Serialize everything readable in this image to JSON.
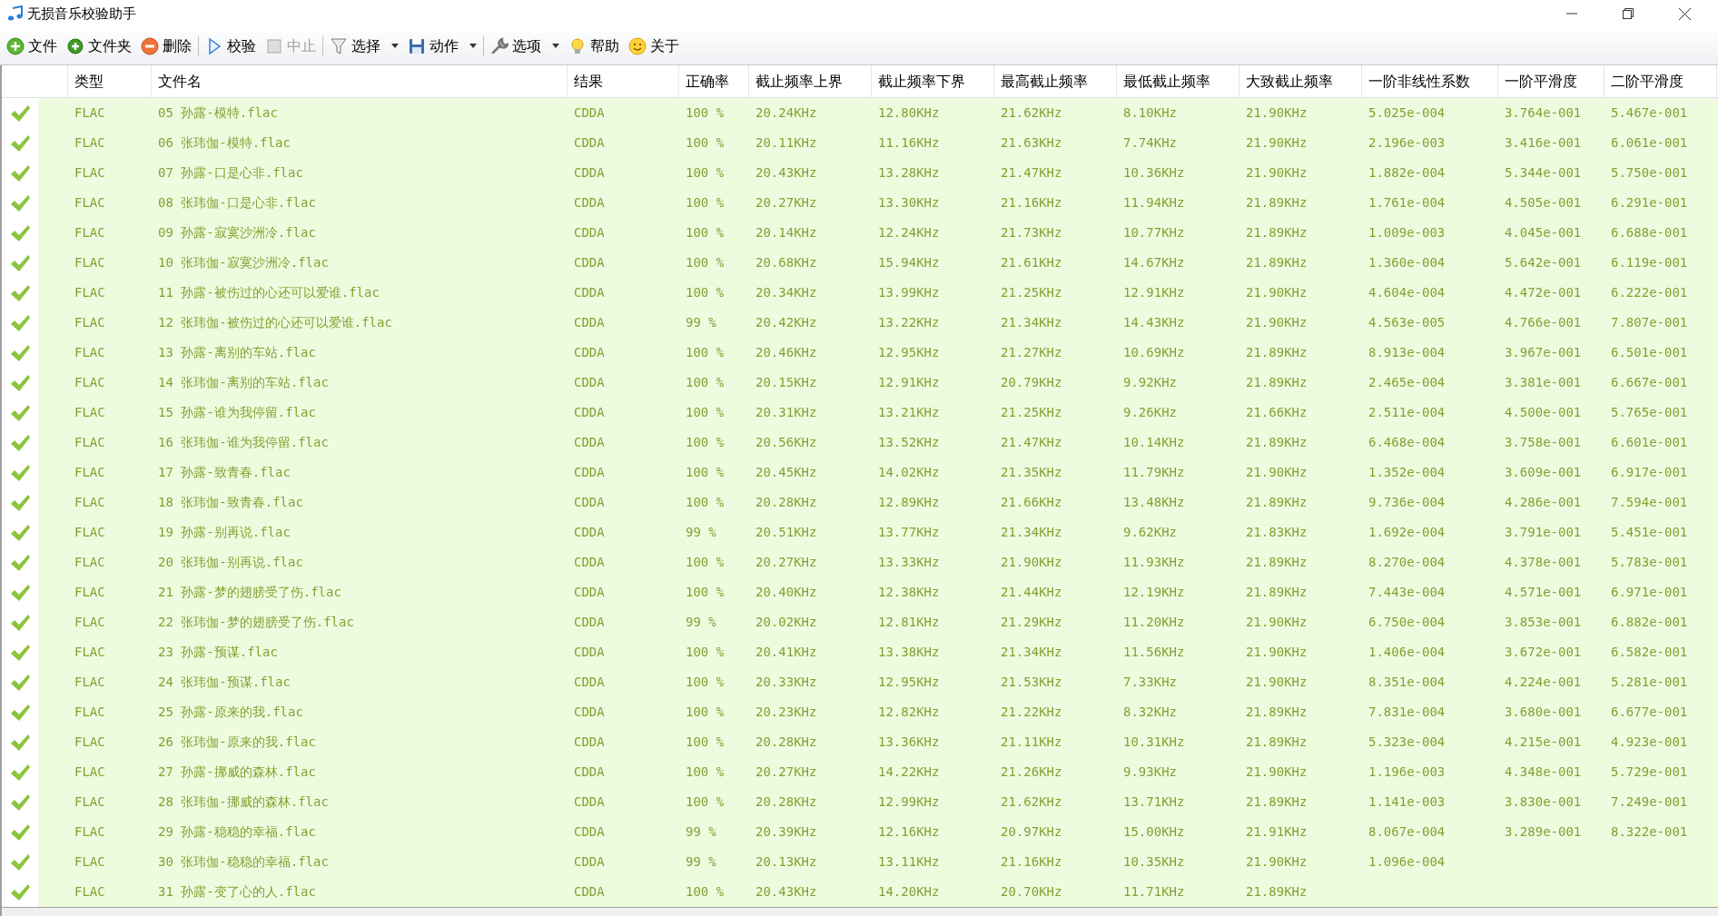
{
  "window": {
    "title": "无损音乐校验助手"
  },
  "toolbar": [
    {
      "label": "文件",
      "kind": "add",
      "dropdown": false,
      "disabled": false,
      "separator_after": false
    },
    {
      "label": "文件夹",
      "kind": "add-folder",
      "dropdown": false,
      "disabled": false,
      "separator_after": false
    },
    {
      "label": "删除",
      "kind": "remove",
      "dropdown": false,
      "disabled": false,
      "separator_after": true
    },
    {
      "label": "校验",
      "kind": "play",
      "dropdown": false,
      "disabled": false,
      "separator_after": false
    },
    {
      "label": "中止",
      "kind": "stop",
      "dropdown": false,
      "disabled": true,
      "separator_after": true
    },
    {
      "label": "选择",
      "kind": "filter",
      "dropdown": true,
      "disabled": false,
      "separator_after": false
    },
    {
      "label": "动作",
      "kind": "save",
      "dropdown": true,
      "disabled": false,
      "separator_after": true
    },
    {
      "label": "选项",
      "kind": "wrench",
      "dropdown": true,
      "disabled": false,
      "separator_after": false
    },
    {
      "label": "帮助",
      "kind": "bulb",
      "dropdown": false,
      "disabled": false,
      "separator_after": false
    },
    {
      "label": "关于",
      "kind": "smile",
      "dropdown": false,
      "disabled": false,
      "separator_after": false
    }
  ],
  "table": {
    "columns": [
      "类型",
      "文件名",
      "结果",
      "正确率",
      "截止频率上界",
      "截止频率下界",
      "最高截止频率",
      "最低截止频率",
      "大致截止频率",
      "一阶非线性系数",
      "一阶平滑度",
      "二阶平滑度"
    ],
    "rows": [
      {
        "kind": "ok",
        "cells": [
          "FLAC",
          "05 孙露-模特.flac",
          "CDDA",
          "100 %",
          "20.24KHz",
          "12.80KHz",
          "21.62KHz",
          "8.10KHz",
          "21.90KHz",
          "5.025e-004",
          "3.764e-001",
          "5.467e-001"
        ]
      },
      {
        "kind": "ok",
        "cells": [
          "FLAC",
          "06 张玮伽-模特.flac",
          "CDDA",
          "100 %",
          "20.11KHz",
          "11.16KHz",
          "21.63KHz",
          "7.74KHz",
          "21.90KHz",
          "2.196e-003",
          "3.416e-001",
          "6.061e-001"
        ]
      },
      {
        "kind": "ok",
        "cells": [
          "FLAC",
          "07 孙露-口是心非.flac",
          "CDDA",
          "100 %",
          "20.43KHz",
          "13.28KHz",
          "21.47KHz",
          "10.36KHz",
          "21.90KHz",
          "1.882e-004",
          "5.344e-001",
          "5.750e-001"
        ]
      },
      {
        "kind": "ok",
        "cells": [
          "FLAC",
          "08 张玮伽-口是心非.flac",
          "CDDA",
          "100 %",
          "20.27KHz",
          "13.30KHz",
          "21.16KHz",
          "11.94KHz",
          "21.89KHz",
          "1.761e-004",
          "4.505e-001",
          "6.291e-001"
        ]
      },
      {
        "kind": "ok",
        "cells": [
          "FLAC",
          "09 孙露-寂寞沙洲冷.flac",
          "CDDA",
          "100 %",
          "20.14KHz",
          "12.24KHz",
          "21.73KHz",
          "10.77KHz",
          "21.89KHz",
          "1.009e-003",
          "4.045e-001",
          "6.688e-001"
        ]
      },
      {
        "kind": "ok",
        "cells": [
          "FLAC",
          "10 张玮伽-寂寞沙洲冷.flac",
          "CDDA",
          "100 %",
          "20.68KHz",
          "15.94KHz",
          "21.61KHz",
          "14.67KHz",
          "21.89KHz",
          "1.360e-004",
          "5.642e-001",
          "6.119e-001"
        ]
      },
      {
        "kind": "ok",
        "cells": [
          "FLAC",
          "11 孙露-被伤过的心还可以爱谁.flac",
          "CDDA",
          "100 %",
          "20.34KHz",
          "13.99KHz",
          "21.25KHz",
          "12.91KHz",
          "21.90KHz",
          "4.604e-004",
          "4.472e-001",
          "6.222e-001"
        ]
      },
      {
        "kind": "ok",
        "cells": [
          "FLAC",
          "12 张玮伽-被伤过的心还可以爱谁.flac",
          "CDDA",
          "99 %",
          "20.42KHz",
          "13.22KHz",
          "21.34KHz",
          "14.43KHz",
          "21.90KHz",
          "4.563e-005",
          "4.766e-001",
          "7.807e-001"
        ]
      },
      {
        "kind": "ok",
        "cells": [
          "FLAC",
          "13 孙露-离别的车站.flac",
          "CDDA",
          "100 %",
          "20.46KHz",
          "12.95KHz",
          "21.27KHz",
          "10.69KHz",
          "21.89KHz",
          "8.913e-004",
          "3.967e-001",
          "6.501e-001"
        ]
      },
      {
        "kind": "ok",
        "cells": [
          "FLAC",
          "14 张玮伽-离别的车站.flac",
          "CDDA",
          "100 %",
          "20.15KHz",
          "12.91KHz",
          "20.79KHz",
          "9.92KHz",
          "21.89KHz",
          "2.465e-004",
          "3.381e-001",
          "6.667e-001"
        ]
      },
      {
        "kind": "ok",
        "cells": [
          "FLAC",
          "15 孙露-谁为我停留.flac",
          "CDDA",
          "100 %",
          "20.31KHz",
          "13.21KHz",
          "21.25KHz",
          "9.26KHz",
          "21.66KHz",
          "2.511e-004",
          "4.500e-001",
          "5.765e-001"
        ]
      },
      {
        "kind": "ok",
        "cells": [
          "FLAC",
          "16 张玮伽-谁为我停留.flac",
          "CDDA",
          "100 %",
          "20.56KHz",
          "13.52KHz",
          "21.47KHz",
          "10.14KHz",
          "21.89KHz",
          "6.468e-004",
          "3.758e-001",
          "6.601e-001"
        ]
      },
      {
        "kind": "ok",
        "cells": [
          "FLAC",
          "17 孙露-致青春.flac",
          "CDDA",
          "100 %",
          "20.45KHz",
          "14.02KHz",
          "21.35KHz",
          "11.79KHz",
          "21.90KHz",
          "1.352e-004",
          "3.609e-001",
          "6.917e-001"
        ]
      },
      {
        "kind": "ok",
        "cells": [
          "FLAC",
          "18 张玮伽-致青春.flac",
          "CDDA",
          "100 %",
          "20.28KHz",
          "12.89KHz",
          "21.66KHz",
          "13.48KHz",
          "21.89KHz",
          "9.736e-004",
          "4.286e-001",
          "7.594e-001"
        ]
      },
      {
        "kind": "ok",
        "cells": [
          "FLAC",
          "19 孙露-别再说.flac",
          "CDDA",
          "99 %",
          "20.51KHz",
          "13.77KHz",
          "21.34KHz",
          "9.62KHz",
          "21.83KHz",
          "1.692e-004",
          "3.791e-001",
          "5.451e-001"
        ]
      },
      {
        "kind": "ok",
        "cells": [
          "FLAC",
          "20 张玮伽-别再说.flac",
          "CDDA",
          "100 %",
          "20.27KHz",
          "13.33KHz",
          "21.90KHz",
          "11.93KHz",
          "21.89KHz",
          "8.270e-004",
          "4.378e-001",
          "5.783e-001"
        ]
      },
      {
        "kind": "ok",
        "cells": [
          "FLAC",
          "21 孙露-梦的翅膀受了伤.flac",
          "CDDA",
          "100 %",
          "20.40KHz",
          "12.38KHz",
          "21.44KHz",
          "12.19KHz",
          "21.89KHz",
          "7.443e-004",
          "4.571e-001",
          "6.971e-001"
        ]
      },
      {
        "kind": "ok",
        "cells": [
          "FLAC",
          "22 张玮伽-梦的翅膀受了伤.flac",
          "CDDA",
          "99 %",
          "20.02KHz",
          "12.81KHz",
          "21.29KHz",
          "11.20KHz",
          "21.90KHz",
          "6.750e-004",
          "3.853e-001",
          "6.882e-001"
        ]
      },
      {
        "kind": "ok",
        "cells": [
          "FLAC",
          "23 孙露-预谋.flac",
          "CDDA",
          "100 %",
          "20.41KHz",
          "13.38KHz",
          "21.34KHz",
          "11.56KHz",
          "21.90KHz",
          "1.406e-004",
          "3.672e-001",
          "6.582e-001"
        ]
      },
      {
        "kind": "ok",
        "cells": [
          "FLAC",
          "24 张玮伽-预谋.flac",
          "CDDA",
          "100 %",
          "20.33KHz",
          "12.95KHz",
          "21.53KHz",
          "7.33KHz",
          "21.90KHz",
          "8.351e-004",
          "4.224e-001",
          "5.281e-001"
        ]
      },
      {
        "kind": "ok",
        "cells": [
          "FLAC",
          "25 孙露-原来的我.flac",
          "CDDA",
          "100 %",
          "20.23KHz",
          "12.82KHz",
          "21.22KHz",
          "8.32KHz",
          "21.89KHz",
          "7.831e-004",
          "3.680e-001",
          "6.677e-001"
        ]
      },
      {
        "kind": "ok",
        "cells": [
          "FLAC",
          "26 张玮伽-原来的我.flac",
          "CDDA",
          "100 %",
          "20.28KHz",
          "13.36KHz",
          "21.11KHz",
          "10.31KHz",
          "21.89KHz",
          "5.323e-004",
          "4.215e-001",
          "4.923e-001"
        ]
      },
      {
        "kind": "ok",
        "cells": [
          "FLAC",
          "27 孙露-挪威的森林.flac",
          "CDDA",
          "100 %",
          "20.27KHz",
          "14.22KHz",
          "21.26KHz",
          "9.93KHz",
          "21.90KHz",
          "1.196e-003",
          "4.348e-001",
          "5.729e-001"
        ]
      },
      {
        "kind": "ok",
        "cells": [
          "FLAC",
          "28 张玮伽-挪威的森林.flac",
          "CDDA",
          "100 %",
          "20.28KHz",
          "12.99KHz",
          "21.62KHz",
          "13.71KHz",
          "21.89KHz",
          "1.141e-003",
          "3.830e-001",
          "7.249e-001"
        ]
      },
      {
        "kind": "ok",
        "cells": [
          "FLAC",
          "29 孙露-稳稳的幸福.flac",
          "CDDA",
          "99 %",
          "20.39KHz",
          "12.16KHz",
          "20.97KHz",
          "15.00KHz",
          "21.91KHz",
          "8.067e-004",
          "3.289e-001",
          "8.322e-001"
        ]
      },
      {
        "kind": "ok",
        "cells": [
          "FLAC",
          "30 张玮伽-稳稳的幸福.flac",
          "CDDA",
          "99 %",
          "20.13KHz",
          "13.11KHz",
          "21.16KHz",
          "10.35KHz",
          "21.90KHz",
          "1.096e-004"
        ]
      },
      {
        "kind": "ok",
        "cells": [
          "FLAC",
          "31 孙露-变了心的人.flac",
          "CDDA",
          "100 %",
          "20.43KHz",
          "14.20KHz",
          "20.70KHz",
          "11.71KHz",
          "21.89KHz"
        ]
      }
    ]
  }
}
